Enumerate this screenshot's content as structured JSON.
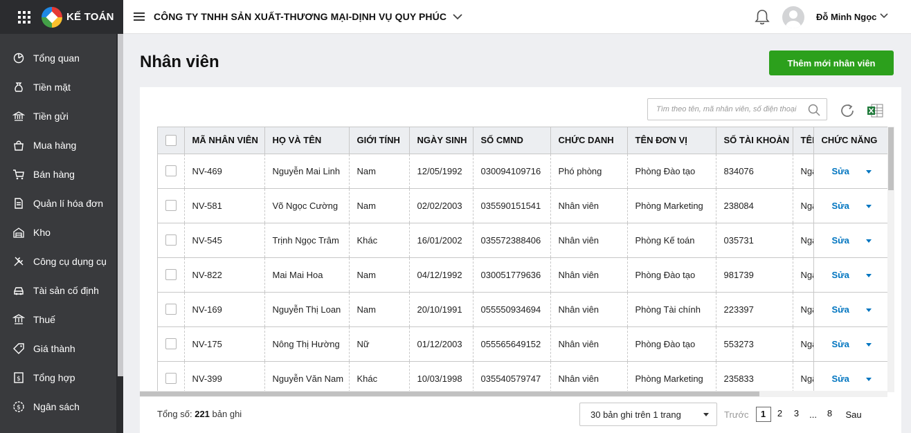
{
  "sidebar": {
    "brand": "KẾ TOÁN",
    "items": [
      {
        "label": "Tổng quan",
        "icon": "dashboard-icon"
      },
      {
        "label": "Tiền mặt",
        "icon": "money-bag-icon"
      },
      {
        "label": "Tiền gửi",
        "icon": "bank-icon"
      },
      {
        "label": "Mua hàng",
        "icon": "shopping-bag-icon"
      },
      {
        "label": "Bán hàng",
        "icon": "cart-icon"
      },
      {
        "label": "Quản lí hóa đơn",
        "icon": "invoice-icon"
      },
      {
        "label": "Kho",
        "icon": "warehouse-icon"
      },
      {
        "label": "Công cụ dụng cụ",
        "icon": "tools-icon"
      },
      {
        "label": "Tài sản cố định",
        "icon": "car-icon"
      },
      {
        "label": "Thuế",
        "icon": "tax-building-icon"
      },
      {
        "label": "Giá thành",
        "icon": "price-tag-icon"
      },
      {
        "label": "Tổng hợp",
        "icon": "summary-icon"
      },
      {
        "label": "Ngân sách",
        "icon": "budget-icon"
      }
    ]
  },
  "header": {
    "company": "CÔNG TY TNHH SẢN XUẤT-THƯƠNG MẠI-DỊNH VỤ QUY PHÚC",
    "user": "Đỗ Minh Ngọc"
  },
  "page": {
    "title": "Nhân viên",
    "add_button": "Thêm mới nhân viên",
    "search_placeholder": "Tìm theo tên, mã nhân viên, số điện thoại"
  },
  "table": {
    "columns": [
      "MÃ NHÂN VIÊN",
      "HỌ VÀ TÊN",
      "GIỚI TÍNH",
      "NGÀY SINH",
      "SỐ CMND",
      "CHỨC DANH",
      "TÊN ĐƠN VỊ",
      "SỐ TÀI KHOẢN",
      "TÊN NGÂN HÀNG",
      "CHỨC NĂNG"
    ],
    "edit_label": "Sửa",
    "rows": [
      {
        "code": "NV-469",
        "name": "Nguyễn Mai Linh",
        "gender": "Nam",
        "dob": "12/05/1992",
        "id_no": "030094109716",
        "position": "Phó phòng",
        "unit": "Phòng Đào tạo",
        "account": "834076",
        "bank": "Ngân hàng"
      },
      {
        "code": "NV-581",
        "name": "Võ Ngọc Cường",
        "gender": "Nam",
        "dob": "02/02/2003",
        "id_no": "035590151541",
        "position": "Nhân viên",
        "unit": "Phòng Marketing",
        "account": "238084",
        "bank": "Ngân hàng"
      },
      {
        "code": "NV-545",
        "name": "Trịnh Ngọc Trâm",
        "gender": "Khác",
        "dob": "16/01/2002",
        "id_no": "035572388406",
        "position": "Nhân viên",
        "unit": "Phòng Kế toán",
        "account": "035731",
        "bank": "Ngân hàng"
      },
      {
        "code": "NV-822",
        "name": "Mai Mai Hoa",
        "gender": "Nam",
        "dob": "04/12/1992",
        "id_no": "030051779636",
        "position": "Nhân viên",
        "unit": "Phòng Đào tạo",
        "account": "981739",
        "bank": "Ngân hàng"
      },
      {
        "code": "NV-169",
        "name": "Nguyễn Thị Loan",
        "gender": "Nam",
        "dob": "20/10/1991",
        "id_no": "055550934694",
        "position": "Nhân viên",
        "unit": "Phòng Tài chính",
        "account": "223397",
        "bank": "Ngân hàng"
      },
      {
        "code": "NV-175",
        "name": "Nông Thị Hường",
        "gender": "Nữ",
        "dob": "01/12/2003",
        "id_no": "055565649152",
        "position": "Nhân viên",
        "unit": "Phòng Đào tạo",
        "account": "553273",
        "bank": "Ngân hàng"
      },
      {
        "code": "NV-399",
        "name": "Nguyễn Văn Nam",
        "gender": "Khác",
        "dob": "10/03/1998",
        "id_no": "035540579747",
        "position": "Nhân viên",
        "unit": "Phòng Marketing",
        "account": "235833",
        "bank": "Ngân hàng"
      }
    ]
  },
  "footer": {
    "total_prefix": "Tổng số:",
    "total_count": "221",
    "total_suffix": "bản ghi",
    "page_size": "30 bản ghi trên 1 trang",
    "prev": "Trước",
    "pages": [
      "1",
      "2",
      "3",
      "...",
      "8"
    ],
    "current_page": "1",
    "next": "Sau"
  },
  "colors": {
    "sidebar": "#393a3d",
    "primary_button": "#2ca01c",
    "link": "#0075c0"
  }
}
